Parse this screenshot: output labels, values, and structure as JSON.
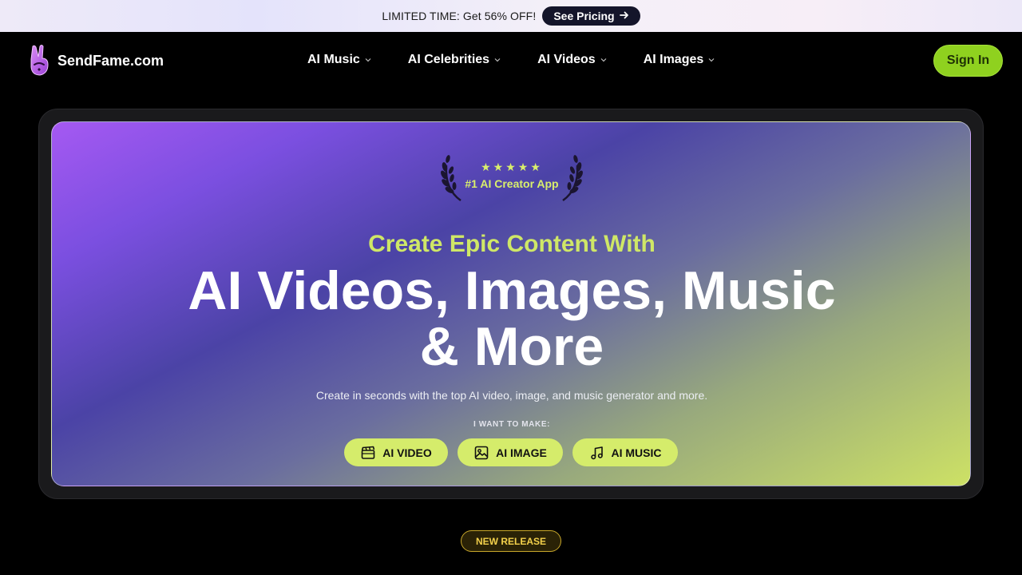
{
  "promo": {
    "text": "LIMITED TIME: Get 56% OFF!",
    "button_label": "See Pricing",
    "button_icon": "arrow-right-icon"
  },
  "nav": {
    "brand": "SendFame.com",
    "logo_icon": "peace-hand-icon",
    "items": [
      {
        "label": "AI Music",
        "icon": "chevron-down-icon"
      },
      {
        "label": "AI Celebrities",
        "icon": "chevron-down-icon"
      },
      {
        "label": "AI Videos",
        "icon": "chevron-down-icon"
      },
      {
        "label": "AI Images",
        "icon": "chevron-down-icon"
      }
    ],
    "signin_label": "Sign In"
  },
  "hero": {
    "stars": "★★★★★",
    "award_text": "#1 AI Creator App",
    "subhead": "Create Epic Content With",
    "headline_line1": "AI Videos, Images, Music",
    "headline_line2": "& More",
    "description": "Create in seconds with the top AI video, image, and music generator and more.",
    "want_label": "I WANT TO MAKE:",
    "buttons": [
      {
        "label": "AI VIDEO",
        "icon": "clapperboard-icon"
      },
      {
        "label": "AI IMAGE",
        "icon": "image-icon"
      },
      {
        "label": "AI MUSIC",
        "icon": "music-note-icon"
      }
    ]
  },
  "badge": {
    "label": "NEW RELEASE"
  },
  "colors": {
    "accent_lime": "#cfe767",
    "signin_green": "#8fd11f",
    "hero_purple": "#a559f2",
    "hero_indigo": "#4b43a6",
    "badge_gold": "#f3d04b"
  }
}
